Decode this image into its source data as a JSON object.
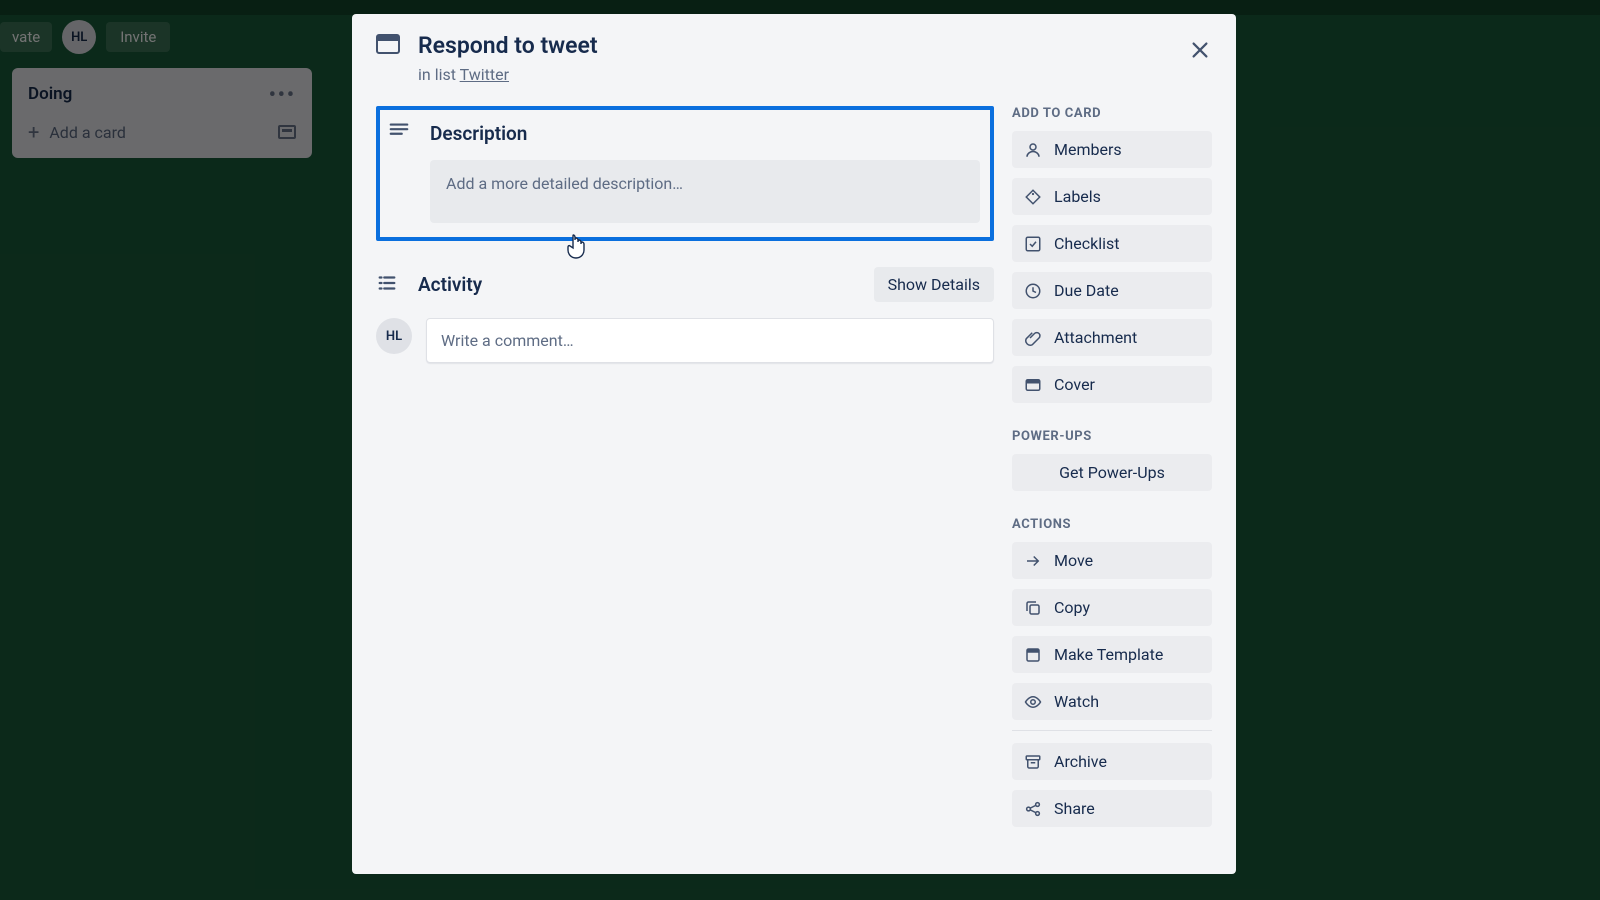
{
  "board": {
    "private_label": "vate",
    "avatar_initials": "HL",
    "invite_label": "Invite",
    "list_title": "Doing",
    "add_card_label": "Add a card"
  },
  "card": {
    "title": "Respond to tweet",
    "inlist_prefix": "in list ",
    "inlist_link": "Twitter"
  },
  "description": {
    "heading": "Description",
    "placeholder": "Add a more detailed description…"
  },
  "activity": {
    "heading": "Activity",
    "show_details": "Show Details",
    "avatar_initials": "HL",
    "comment_placeholder": "Write a comment…"
  },
  "sidebar": {
    "add_heading": "ADD TO CARD",
    "add_items": [
      {
        "icon": "user",
        "label": "Members"
      },
      {
        "icon": "tag",
        "label": "Labels"
      },
      {
        "icon": "check",
        "label": "Checklist"
      },
      {
        "icon": "clock",
        "label": "Due Date"
      },
      {
        "icon": "attach",
        "label": "Attachment"
      },
      {
        "icon": "cover",
        "label": "Cover"
      }
    ],
    "powerups_heading": "POWER-UPS",
    "powerups_label": "Get Power-Ups",
    "actions_heading": "ACTIONS",
    "actions_items": [
      {
        "icon": "arrow",
        "label": "Move"
      },
      {
        "icon": "copy",
        "label": "Copy"
      },
      {
        "icon": "template",
        "label": "Make Template"
      },
      {
        "icon": "eye",
        "label": "Watch"
      }
    ],
    "archive_label": "Archive",
    "share_label": "Share"
  }
}
